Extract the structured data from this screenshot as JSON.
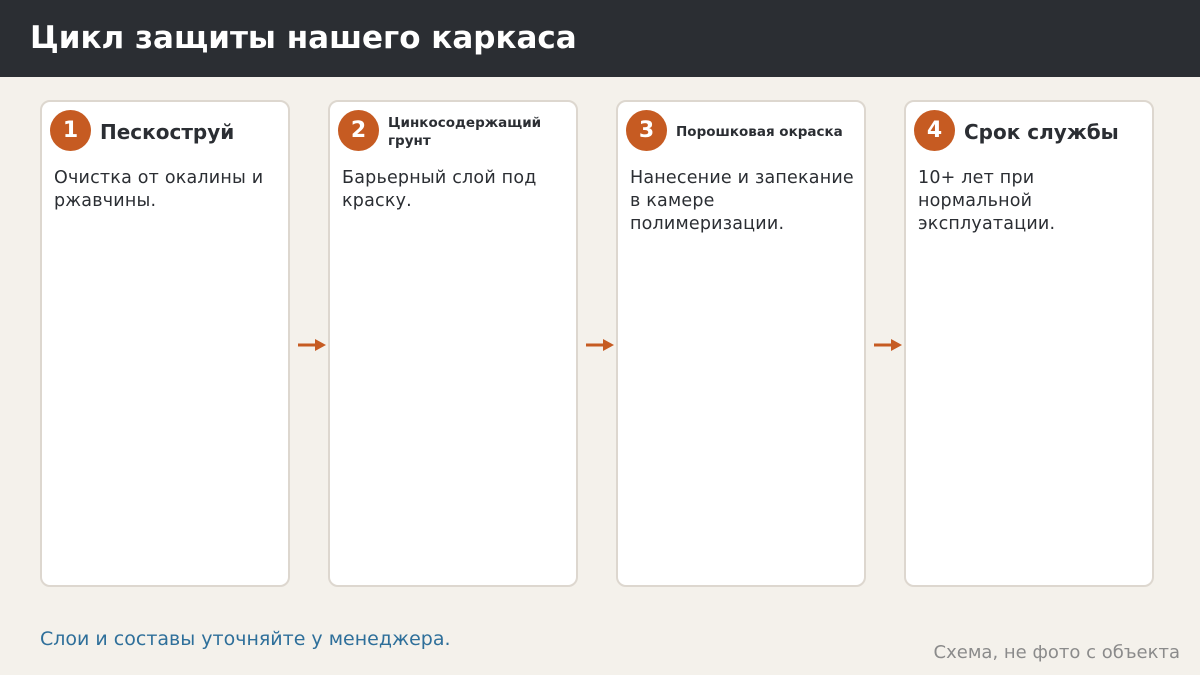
{
  "header": {
    "title": "Цикл защиты нашего каркаса"
  },
  "steps": [
    {
      "number": "1",
      "title": "Пескоструй",
      "description": "Очистка от окалины и ржавчины."
    },
    {
      "number": "2",
      "title": "Цинкосодержащий грунт",
      "description": "Барьерный слой под краску."
    },
    {
      "number": "3",
      "title": "Порошковая окраска",
      "description": "Нанесение и запекание в камере полимеризации."
    },
    {
      "number": "4",
      "title": "Срок службы",
      "description": "10+ лет при нормальной эксплуатации."
    }
  ],
  "footer": {
    "note": "Слои и составы уточняйте у менеджера.",
    "caption": "Схема, не фото с объекта"
  },
  "colors": {
    "header_bg": "#2b2e33",
    "accent": "#c65b22",
    "note_text": "#2e6f9a",
    "page_bg": "#f4f1eb"
  }
}
